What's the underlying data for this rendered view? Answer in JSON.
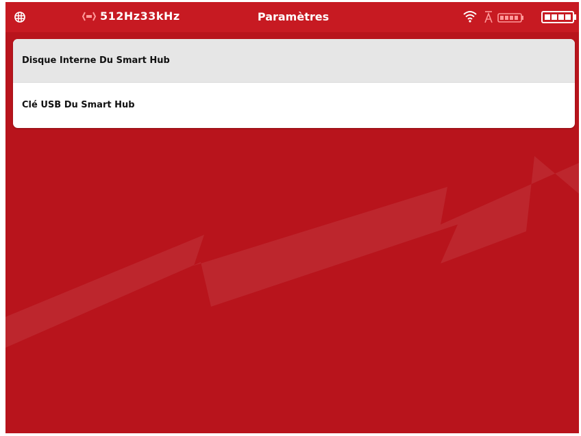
{
  "status_bar": {
    "frequency": "512Hz33kHz",
    "title": "Paramètres",
    "left_icon": "network-grid-icon",
    "right_icons": [
      "wifi-icon",
      "a-bar-icon",
      "small-battery-icon",
      "battery-icon"
    ]
  },
  "list": {
    "items": [
      {
        "label": "Disque Interne Du Smart Hub",
        "selected": true
      },
      {
        "label": "Clé USB Du Smart Hub",
        "selected": false
      }
    ]
  },
  "colors": {
    "background": "#b8141c",
    "status_bar": "#c71a22",
    "list_bg": "#ffffff",
    "selected_row": "#e6e6e6"
  }
}
